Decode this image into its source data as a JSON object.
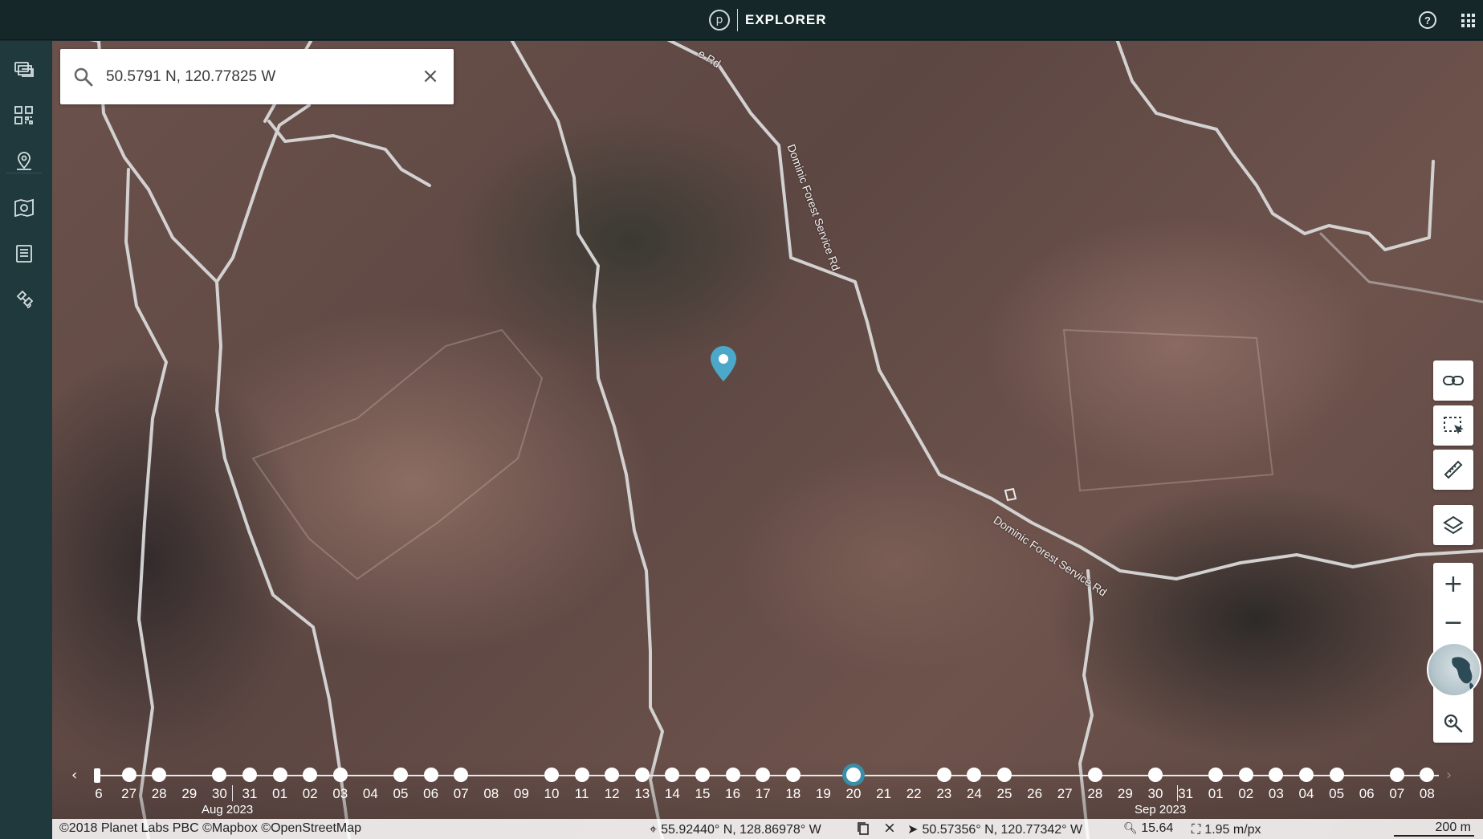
{
  "app": {
    "title": "EXPLORER",
    "logo_letter": "p"
  },
  "search": {
    "value": "50.5791 N, 120.77825 W",
    "placeholder": "Search"
  },
  "sidebar": {
    "items": [
      {
        "name": "mosaics",
        "icon": "stack-icon"
      },
      {
        "name": "grid",
        "icon": "qr-grid-icon"
      },
      {
        "name": "places",
        "icon": "map-pin-icon"
      },
      {
        "name": "map-search",
        "icon": "map-camera-icon"
      },
      {
        "name": "reports",
        "icon": "document-list-icon"
      },
      {
        "name": "tasking",
        "icon": "satellite-icon"
      }
    ],
    "settings_icon": "gear-icon"
  },
  "map": {
    "road_labels": [
      "e Rd",
      "Dominic Forest Service Rd",
      "Dominic Forest Service Rd"
    ]
  },
  "tools": {
    "link": "link-icon",
    "select": "select-area-icon",
    "measure": "ruler-icon",
    "layers": "layers-icon",
    "zoom_in": "+",
    "zoom_out": "−",
    "zoom_search": "zoom-search-icon"
  },
  "timeline": {
    "days": [
      {
        "label": "6",
        "dot": false
      },
      {
        "label": "27",
        "dot": true
      },
      {
        "label": "28",
        "dot": true
      },
      {
        "label": "29",
        "dot": false
      },
      {
        "label": "30",
        "dot": true
      },
      {
        "label": "31",
        "dot": true
      },
      {
        "label": "01",
        "dot": true
      },
      {
        "label": "02",
        "dot": true
      },
      {
        "label": "03",
        "dot": true
      },
      {
        "label": "04",
        "dot": false
      },
      {
        "label": "05",
        "dot": true
      },
      {
        "label": "06",
        "dot": true
      },
      {
        "label": "07",
        "dot": true
      },
      {
        "label": "08",
        "dot": false
      },
      {
        "label": "09",
        "dot": false
      },
      {
        "label": "10",
        "dot": true
      },
      {
        "label": "11",
        "dot": true
      },
      {
        "label": "12",
        "dot": true
      },
      {
        "label": "13",
        "dot": true
      },
      {
        "label": "14",
        "dot": true
      },
      {
        "label": "15",
        "dot": true
      },
      {
        "label": "16",
        "dot": true
      },
      {
        "label": "17",
        "dot": true
      },
      {
        "label": "18",
        "dot": true
      },
      {
        "label": "19",
        "dot": false
      },
      {
        "label": "20",
        "dot": true,
        "selected": true
      },
      {
        "label": "21",
        "dot": false
      },
      {
        "label": "22",
        "dot": false
      },
      {
        "label": "23",
        "dot": true
      },
      {
        "label": "24",
        "dot": true
      },
      {
        "label": "25",
        "dot": true
      },
      {
        "label": "26",
        "dot": false
      },
      {
        "label": "27",
        "dot": false
      },
      {
        "label": "28",
        "dot": true
      },
      {
        "label": "29",
        "dot": false
      },
      {
        "label": "30",
        "dot": true
      },
      {
        "label": "31",
        "dot": false
      },
      {
        "label": "01",
        "dot": true
      },
      {
        "label": "02",
        "dot": true
      },
      {
        "label": "03",
        "dot": true
      },
      {
        "label": "04",
        "dot": true
      },
      {
        "label": "05",
        "dot": true
      },
      {
        "label": "06",
        "dot": false
      },
      {
        "label": "07",
        "dot": true
      },
      {
        "label": "08",
        "dot": true
      }
    ],
    "months": [
      "Aug 2023",
      "Sep 2023"
    ],
    "accent": "#3a8ea8"
  },
  "status": {
    "attribution": "©2018 Planet Labs PBC ©Mapbox ©OpenStreetMap",
    "cursor_coords": "55.92440° N, 128.86978° W",
    "center_coords": "50.57356° N, 120.77342° W",
    "zoom": "15.64",
    "resolution": "1.95 m/px",
    "scale": "200 m"
  },
  "colors": {
    "topbar": "#152729",
    "sidebar": "#1f393d",
    "pin": "#4ba8c9"
  }
}
